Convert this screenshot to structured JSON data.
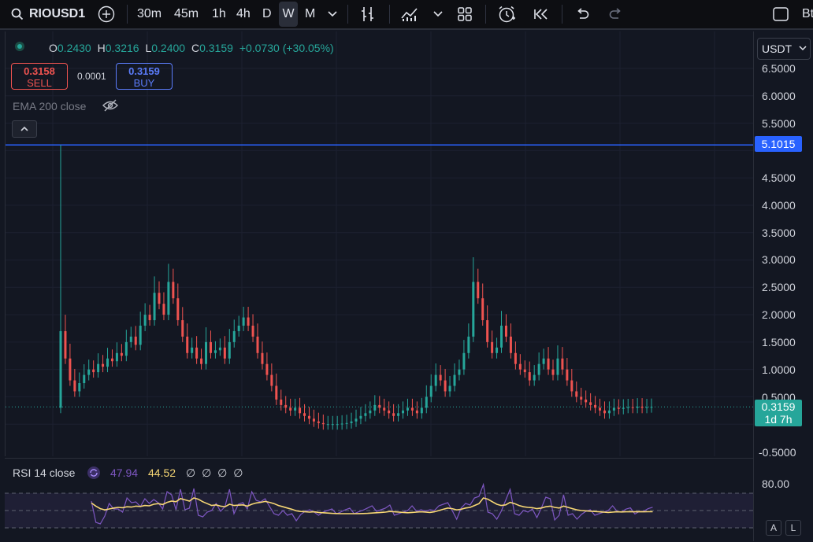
{
  "toolbar": {
    "symbol": "RIOUSD1",
    "intervals": [
      "30m",
      "45m",
      "1h",
      "4h",
      "D",
      "W",
      "M"
    ],
    "active_interval": "W",
    "right_text": "Bt"
  },
  "legend": {
    "o_label": "O",
    "o_value": "0.2430",
    "h_label": "H",
    "h_value": "0.3216",
    "l_label": "L",
    "l_value": "0.2400",
    "c_label": "C",
    "c_value": "0.3159",
    "change": "+0.0730 (+30.05%)"
  },
  "trade": {
    "sell_price": "0.3158",
    "sell_label": "SELL",
    "spread": "0.0001",
    "buy_price": "0.3159",
    "buy_label": "BUY"
  },
  "indicator": {
    "ema_label": "EMA 200 close"
  },
  "currency": "USDT",
  "price_axis": {
    "labels": [
      "6.5000",
      "6.0000",
      "5.5000",
      "5.1015",
      "4.5000",
      "4.0000",
      "3.5000",
      "3.0000",
      "2.5000",
      "2.0000",
      "1.5000",
      "1.0000",
      "0.5000",
      "-0.5000"
    ],
    "hline_label": "5.1015",
    "current_price": "0.3159",
    "countdown": "1d 7h"
  },
  "rsi": {
    "label": "RSI 14 close",
    "value": "47.94",
    "ma_value": "44.52",
    "placeholders": "∅ ∅ ∅ ∅",
    "axis_label": "80.00",
    "colors": {
      "rsi": "#7e57c2",
      "ma": "#f7d774"
    }
  },
  "buttons": {
    "a": "A",
    "l": "L"
  },
  "colors": {
    "up": "#26a69a",
    "down": "#ef5350",
    "hline": "#2962ff",
    "accent": "#2962ff"
  },
  "chart_data": {
    "type": "candlestick",
    "y_min": -0.5,
    "y_max": 6.5,
    "hline": 5.1015,
    "current": 0.3159,
    "close_series": [
      1.7,
      1.2,
      0.8,
      0.6,
      0.75,
      0.9,
      1.0,
      0.95,
      1.1,
      1.05,
      1.2,
      1.15,
      1.3,
      1.25,
      1.5,
      1.6,
      1.45,
      1.8,
      2.0,
      1.9,
      2.4,
      2.2,
      2.0,
      2.6,
      2.3,
      1.9,
      1.6,
      1.3,
      1.4,
      1.2,
      1.1,
      1.5,
      1.3,
      1.35,
      1.4,
      1.2,
      1.5,
      1.7,
      1.8,
      1.95,
      1.8,
      1.6,
      1.3,
      1.1,
      0.9,
      0.7,
      0.45,
      0.35,
      0.3,
      0.25,
      0.3,
      0.2,
      0.15,
      0.1,
      0.05,
      0.02,
      0.0,
      0.0,
      0.0,
      0.0,
      0.01,
      0.02,
      0.05,
      0.1,
      0.15,
      0.2,
      0.25,
      0.35,
      0.3,
      0.25,
      0.2,
      0.15,
      0.2,
      0.25,
      0.3,
      0.25,
      0.2,
      0.3,
      0.5,
      0.7,
      0.9,
      0.8,
      0.6,
      0.7,
      0.9,
      1.0,
      1.3,
      1.6,
      2.6,
      2.3,
      1.9,
      1.5,
      1.3,
      1.4,
      1.8,
      1.6,
      1.3,
      1.1,
      1.0,
      0.95,
      0.8,
      0.9,
      1.1,
      1.2,
      1.0,
      0.9,
      1.2,
      1.0,
      0.8,
      0.6,
      0.5,
      0.45,
      0.4,
      0.35,
      0.3,
      0.25,
      0.2,
      0.25,
      0.3,
      0.28,
      0.3,
      0.31,
      0.3,
      0.32,
      0.3,
      0.31,
      0.3159
    ]
  }
}
